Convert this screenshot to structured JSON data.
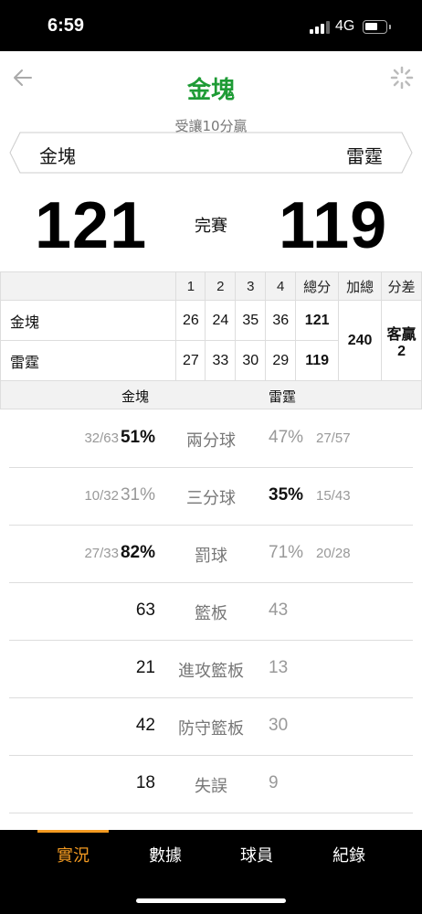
{
  "status_bar": {
    "time": "6:59",
    "network": "4G"
  },
  "header": {
    "title": "金塊",
    "handicap": "受讓10分贏"
  },
  "teams": {
    "left": "金塊",
    "right": "雷霆"
  },
  "score": {
    "left": "121",
    "right": "119",
    "status": "完賽"
  },
  "box_score": {
    "headers": [
      "1",
      "2",
      "3",
      "4",
      "總分",
      "加總",
      "分差"
    ],
    "rows": [
      {
        "team": "金塊",
        "q": [
          "26",
          "24",
          "35",
          "36"
        ],
        "total": "121"
      },
      {
        "team": "雷霆",
        "q": [
          "27",
          "33",
          "30",
          "29"
        ],
        "total": "119"
      }
    ],
    "sum": "240",
    "diff_label": "客贏",
    "diff_value": "2",
    "footer_left": "金塊",
    "footer_right": "雷霆"
  },
  "stats": [
    {
      "label": "兩分球",
      "left_frac": "32/63",
      "left": "51%",
      "right": "47%",
      "right_frac": "27/57"
    },
    {
      "label": "三分球",
      "left_frac": "10/32",
      "left": "31%",
      "right": "35%",
      "right_frac": "15/43"
    },
    {
      "label": "罰球",
      "left_frac": "27/33",
      "left": "82%",
      "right": "71%",
      "right_frac": "20/28"
    },
    {
      "label": "籃板",
      "left_frac": "",
      "left": "63",
      "right": "43",
      "right_frac": ""
    },
    {
      "label": "進攻籃板",
      "left_frac": "",
      "left": "21",
      "right": "13",
      "right_frac": ""
    },
    {
      "label": "防守籃板",
      "left_frac": "",
      "left": "42",
      "right": "30",
      "right_frac": ""
    },
    {
      "label": "失誤",
      "left_frac": "",
      "left": "18",
      "right": "9",
      "right_frac": ""
    }
  ],
  "tabs": [
    "實況",
    "數據",
    "球員",
    "紀錄"
  ],
  "colors": {
    "accent": "#f39a21",
    "title_green": "#1e9b35"
  }
}
